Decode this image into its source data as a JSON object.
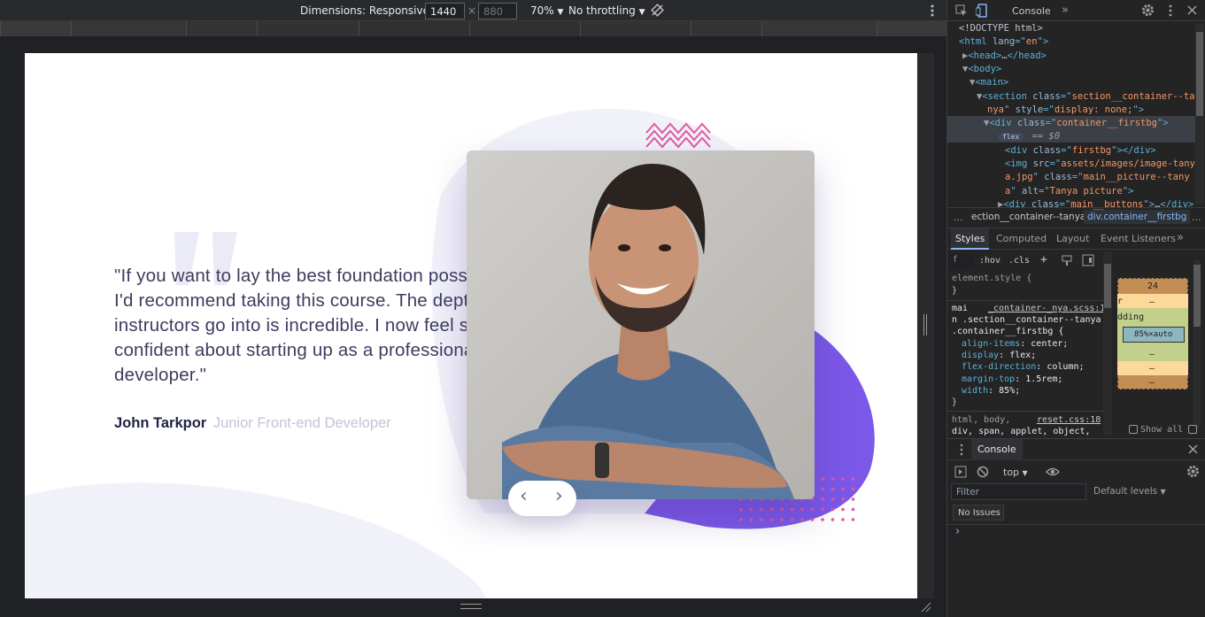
{
  "toolbar": {
    "dimensions_label": "Dimensions: Responsive",
    "width": "1440",
    "times": "×",
    "height_placeholder": "880",
    "zoom": "70%",
    "throttling": "No throttling"
  },
  "page": {
    "quote_mark": "\"",
    "quote": "\"If you want to lay the best foundation possible I'd recommend taking this course. The depth the instructors go into is incredible. I now feel so confident about starting up as a professional developer.\"",
    "author_name": "John Tarkpor",
    "author_role": "Junior Front-end Developer",
    "prev_label": "‹",
    "next_label": "›",
    "colors": {
      "accent": "#6b5ee6",
      "heading": "#202442",
      "muted": "#c3c3d8",
      "blob": "#f1f1fa",
      "zigzag": "#e05a9e"
    }
  },
  "devtools": {
    "top_tabs": {
      "console": "Console"
    },
    "elements": [
      {
        "text_parts": [
          [
            "plain",
            "<!DOCTYPE html>"
          ]
        ]
      },
      {
        "text_parts": [
          [
            "tag",
            "<html "
          ],
          [
            "attr",
            "lang"
          ],
          [
            "tag",
            "=\""
          ],
          [
            "val",
            "en"
          ],
          [
            "tag",
            "\">"
          ]
        ]
      },
      {
        "text_parts": [
          [
            "tri",
            "▶"
          ],
          [
            "tag",
            "<head>"
          ],
          [
            "plain",
            "…"
          ],
          [
            "tag",
            "</head>"
          ]
        ]
      },
      {
        "text_parts": [
          [
            "tri",
            "▼"
          ],
          [
            "tag",
            "<body>"
          ]
        ]
      },
      {
        "text_parts": [
          [
            "tri",
            "▼"
          ],
          [
            "tag",
            "<main>"
          ]
        ]
      },
      {
        "text_parts": [
          [
            "tri",
            "▼"
          ],
          [
            "tag",
            "<section "
          ],
          [
            "attr",
            "class"
          ],
          [
            "tag",
            "=\""
          ],
          [
            "val",
            "section__container--ta"
          ]
        ]
      },
      {
        "text_parts": [
          [
            "val",
            "nya"
          ],
          [
            "tag",
            "\" "
          ],
          [
            "attr",
            "style"
          ],
          [
            "tag",
            "=\""
          ],
          [
            "val",
            "display: none;"
          ],
          [
            "tag",
            "\">"
          ]
        ]
      },
      {
        "text_parts": [
          [
            "tri",
            "▼"
          ],
          [
            "tag",
            "<div "
          ],
          [
            "attr",
            "class"
          ],
          [
            "tag",
            "=\""
          ],
          [
            "val",
            "container__firstbg"
          ],
          [
            "tag",
            "\">"
          ]
        ]
      },
      {
        "text_parts": [
          [
            "plain",
            "flex"
          ],
          [
            "plain",
            " == $0"
          ]
        ]
      },
      {
        "text_parts": [
          [
            "tag",
            "<div "
          ],
          [
            "attr",
            "class"
          ],
          [
            "tag",
            "=\""
          ],
          [
            "val",
            "firstbg"
          ],
          [
            "tag",
            "\"></div>"
          ]
        ]
      },
      {
        "text_parts": [
          [
            "tag",
            "<img "
          ],
          [
            "attr",
            "src"
          ],
          [
            "tag",
            "=\""
          ],
          [
            "val",
            "assets/images/image-tany"
          ]
        ]
      },
      {
        "text_parts": [
          [
            "val",
            "a.jpg"
          ],
          [
            "tag",
            "\" "
          ],
          [
            "attr",
            "class"
          ],
          [
            "tag",
            "=\""
          ],
          [
            "val",
            "main__picture--tany"
          ]
        ]
      },
      {
        "text_parts": [
          [
            "val",
            "a"
          ],
          [
            "tag",
            "\" "
          ],
          [
            "attr",
            "alt"
          ],
          [
            "tag",
            "=\""
          ],
          [
            "val",
            "Tanya picture"
          ],
          [
            "tag",
            "\">"
          ]
        ]
      },
      {
        "text_parts": [
          [
            "tri",
            "▶"
          ],
          [
            "tag",
            "<div "
          ],
          [
            "attr",
            "class"
          ],
          [
            "tag",
            "=\""
          ],
          [
            "val",
            "main__buttons"
          ],
          [
            "tag",
            "\">"
          ],
          [
            "plain",
            "…"
          ],
          [
            "tag",
            "</div>"
          ]
        ]
      }
    ],
    "breadcrumbs": [
      "...",
      "ection__container--tanya",
      "div.container__firstbg",
      "..."
    ],
    "styles_tabs": [
      "Styles",
      "Computed",
      "Layout",
      "Event Listeners",
      "»"
    ],
    "filter_placeholder": "f",
    "hov": ":hov",
    "cls": ".cls",
    "element_style": "element.style {",
    "close_brace": "}",
    "rule_source": "_container-_nya.scss:13",
    "rule_selector_1": "mai",
    "rule_selector_2": "n .section__container--tanya",
    "rule_selector_3": ".container__firstbg {",
    "decls": [
      {
        "prop": "align-items",
        "value": "center;"
      },
      {
        "prop": "display",
        "value": "flex;"
      },
      {
        "prop": "flex-direction",
        "value": "column;"
      },
      {
        "prop": "margin-top",
        "value": "1.5rem;"
      },
      {
        "prop": "width",
        "value": "85%;"
      }
    ],
    "reset_source": "reset.css:18",
    "reset_sel_1": "html, body,",
    "reset_sel_2": "div, span, applet, object,",
    "box_model": {
      "margin": "24",
      "dash": "–",
      "padding_label": "dding",
      "border_label": "r",
      "content": "85%×auto"
    },
    "show_all": "Show all",
    "drawer_tab": "Console",
    "top_context": "top",
    "filter": "Filter",
    "default_levels": "Default levels",
    "no_issues": "No Issues",
    "prompt": "›"
  }
}
